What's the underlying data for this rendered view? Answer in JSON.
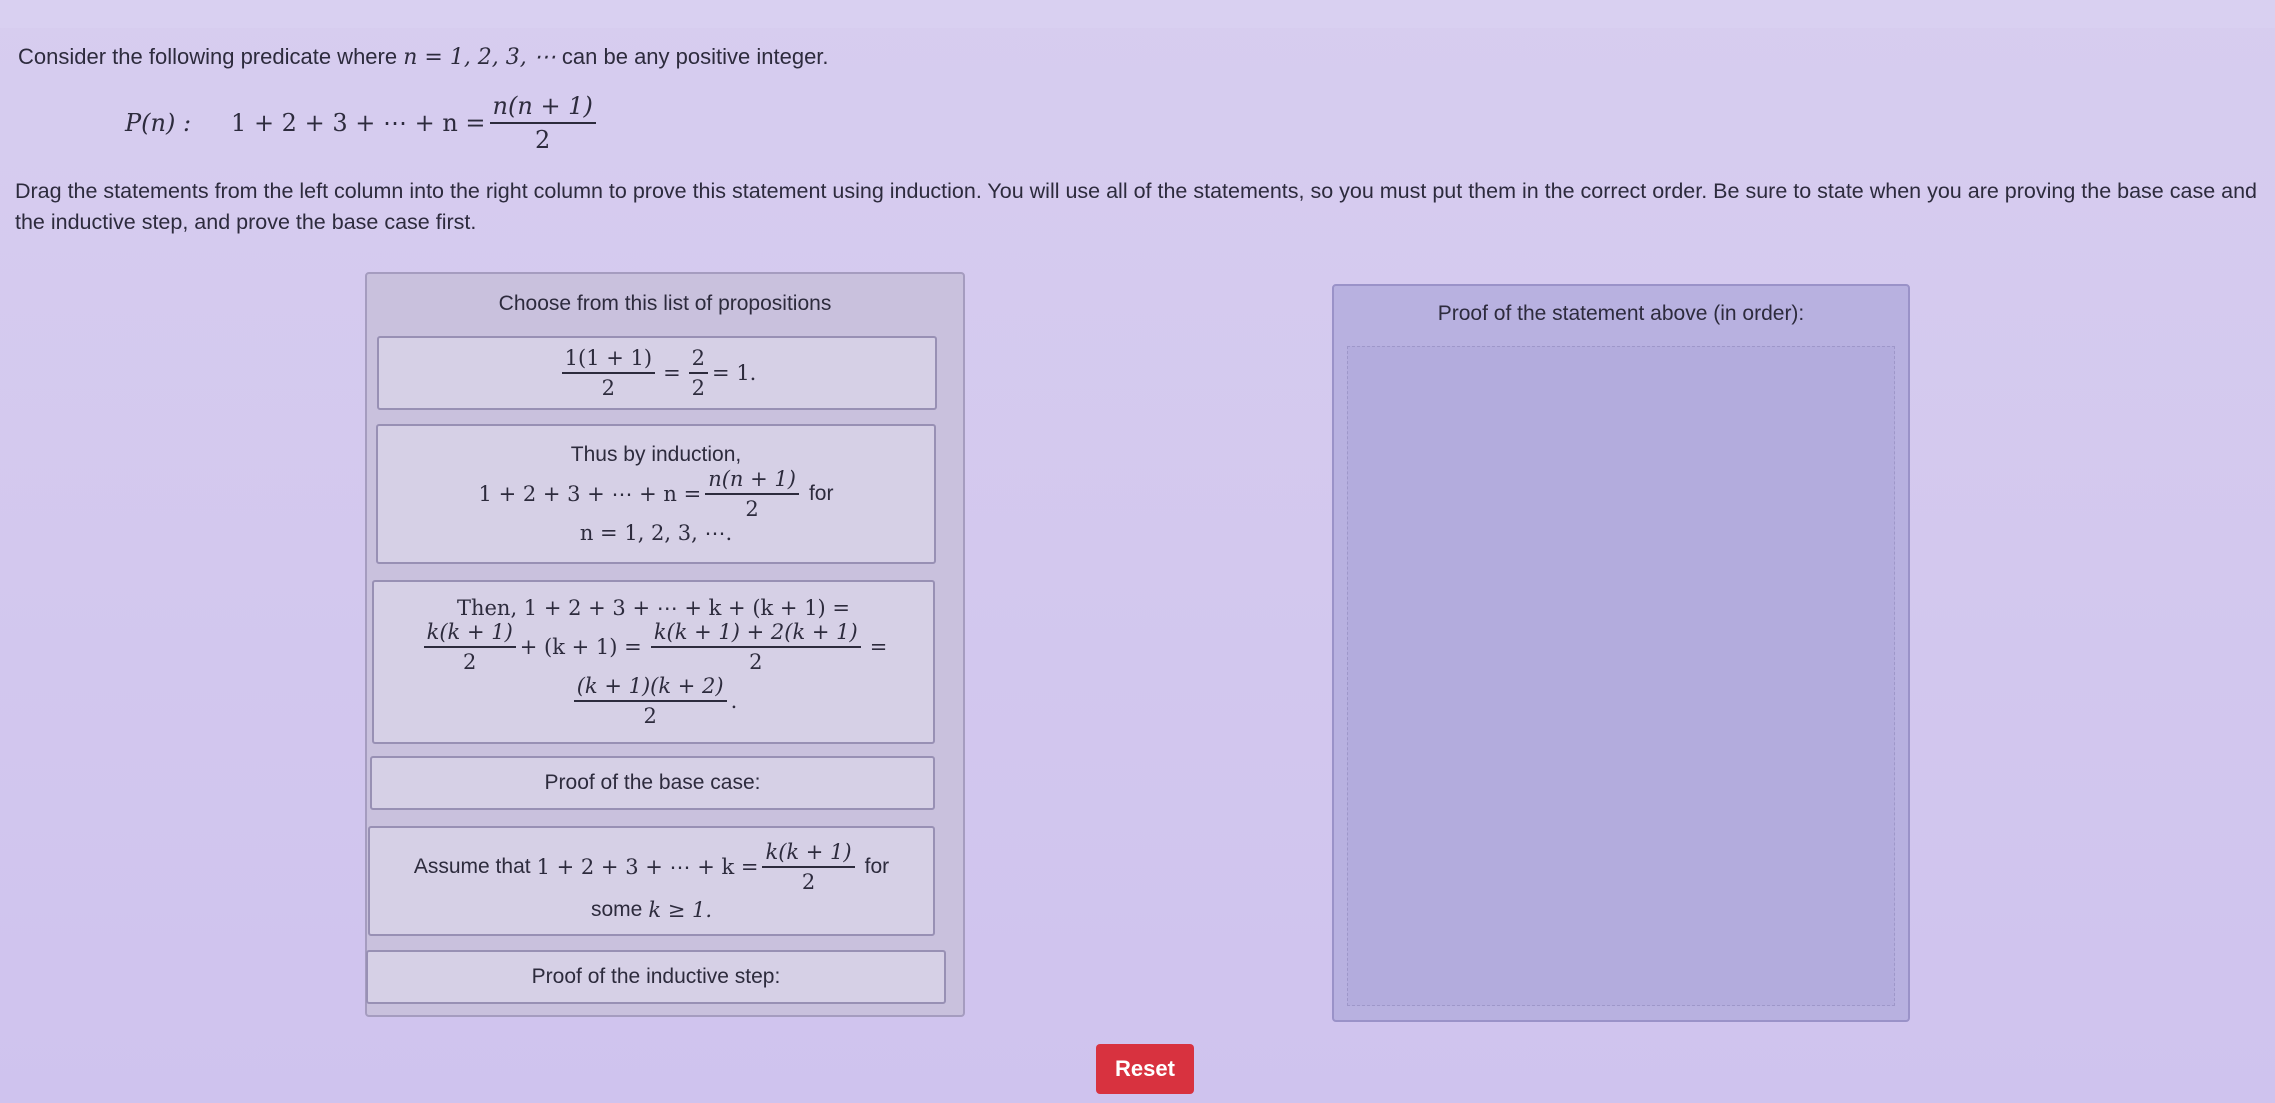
{
  "question": {
    "intro_prefix": "Consider the following predicate where",
    "intro_math": "n = 1, 2, 3, ⋯",
    "intro_suffix": "can be any positive integer.",
    "predicate_label": "P(n) :",
    "predicate_lhs": "1 + 2 + 3 + ⋯ + n =",
    "predicate_num": "n(n + 1)",
    "predicate_den": "2",
    "instructions": "Drag the statements from the left column into the right column to prove this statement using induction. You will use all of the statements, so you must put them in the correct order. Be sure to state when you are proving the base case and the inductive step, and prove the base case first."
  },
  "left_panel": {
    "title": "Choose from this list of propositions",
    "card1": {
      "num1": "1(1 + 1)",
      "den1": "2",
      "eq1": "=",
      "num2": "2",
      "den2": "2",
      "rest": "= 1."
    },
    "card2": {
      "line1": "Thus by induction,",
      "lhs": "1 + 2 + 3 + ⋯ + n =",
      "num": "n(n + 1)",
      "den": "2",
      "for": "for",
      "line3": "n = 1, 2, 3, ⋯."
    },
    "card3": {
      "line1": "Then, 1 + 2 + 3 + ⋯ + k + (k + 1) =",
      "num1": "k(k + 1)",
      "den1": "2",
      "mid": "+ (k + 1) =",
      "num2": "k(k + 1) + 2(k + 1)",
      "den2": "2",
      "eq": "=",
      "num3": "(k + 1)(k + 2)",
      "den3": "2",
      "dot": "."
    },
    "card4": {
      "text": "Proof of the base case:"
    },
    "card5": {
      "prefix": "Assume that",
      "lhs": "1 + 2 + 3 + ⋯ + k =",
      "num": "k(k + 1)",
      "den": "2",
      "for": "for",
      "line2_text": "some",
      "line2_math": "k ≥ 1."
    },
    "card6": {
      "text": "Proof of the inductive step:"
    }
  },
  "right_panel": {
    "title": "Proof of the statement above (in order):"
  },
  "buttons": {
    "reset": "Reset"
  },
  "colors": {
    "background": "#d3c9f0",
    "reset": "#d8323f",
    "drop_zone": "#b3acdd"
  }
}
